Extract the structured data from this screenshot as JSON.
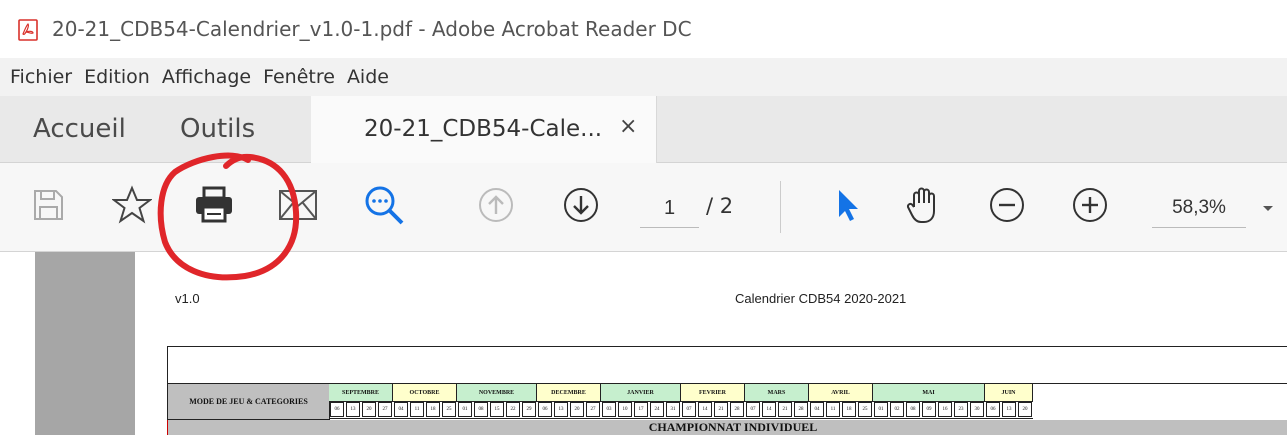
{
  "window": {
    "title": "20-21_CDB54-Calendrier_v1.0-1.pdf - Adobe Acrobat Reader DC",
    "icon": "acrobat-pdf-icon",
    "accent": "#d9312b"
  },
  "menubar": {
    "items": [
      "Fichier",
      "Edition",
      "Affichage",
      "Fenêtre",
      "Aide"
    ]
  },
  "tabs": {
    "home": "Accueil",
    "tools": "Outils",
    "document": "20-21_CDB54-Cale...",
    "close_glyph": "×"
  },
  "toolbar": {
    "icons": [
      "save-icon",
      "bookmark-star-icon",
      "print-icon",
      "email-icon",
      "search-zoom-icon",
      "prev-page-icon",
      "next-page-icon",
      "select-cursor-icon",
      "hand-tool-icon",
      "zoom-out-icon",
      "zoom-in-icon"
    ],
    "page_current": "1",
    "page_total": "/ 2",
    "zoom": "58,3%",
    "accent_blue": "#1473e6"
  },
  "annotation": {
    "color": "#e0262a",
    "shape": "hand-drawn circle around print button"
  },
  "document": {
    "version": "v1.0",
    "title": "Calendrier CDB54 2020-2021",
    "mode_header": "MODE DE JEU & CATEGORIES",
    "months": [
      {
        "name": "SEPTEMBRE",
        "color": "#c6efce",
        "days": [
          "06",
          "13",
          "20",
          "27"
        ]
      },
      {
        "name": "OCTOBRE",
        "color": "#ffffcc",
        "days": [
          "04",
          "11",
          "18",
          "25"
        ]
      },
      {
        "name": "NOVEMBRE",
        "color": "#c6efce",
        "days": [
          "01",
          "08",
          "15",
          "22",
          "29"
        ]
      },
      {
        "name": "DECEMBRE",
        "color": "#ffffcc",
        "days": [
          "06",
          "13",
          "20",
          "27"
        ]
      },
      {
        "name": "JANVIER",
        "color": "#c6efce",
        "days": [
          "03",
          "10",
          "17",
          "24",
          "31"
        ]
      },
      {
        "name": "FEVRIER",
        "color": "#ffffcc",
        "days": [
          "07",
          "14",
          "21",
          "28"
        ]
      },
      {
        "name": "MARS",
        "color": "#c6efce",
        "days": [
          "07",
          "14",
          "21",
          "28"
        ]
      },
      {
        "name": "AVRIL",
        "color": "#ffffcc",
        "days": [
          "04",
          "11",
          "18",
          "25"
        ]
      },
      {
        "name": "MAI",
        "color": "#c6efce",
        "days": [
          "01",
          "02",
          "08",
          "09",
          "16",
          "23",
          "30"
        ]
      },
      {
        "name": "JUIN",
        "color": "#ffffcc",
        "days": [
          "06",
          "13",
          "20"
        ]
      }
    ],
    "section": "CHAMPIONNAT INDIVIDUEL"
  }
}
